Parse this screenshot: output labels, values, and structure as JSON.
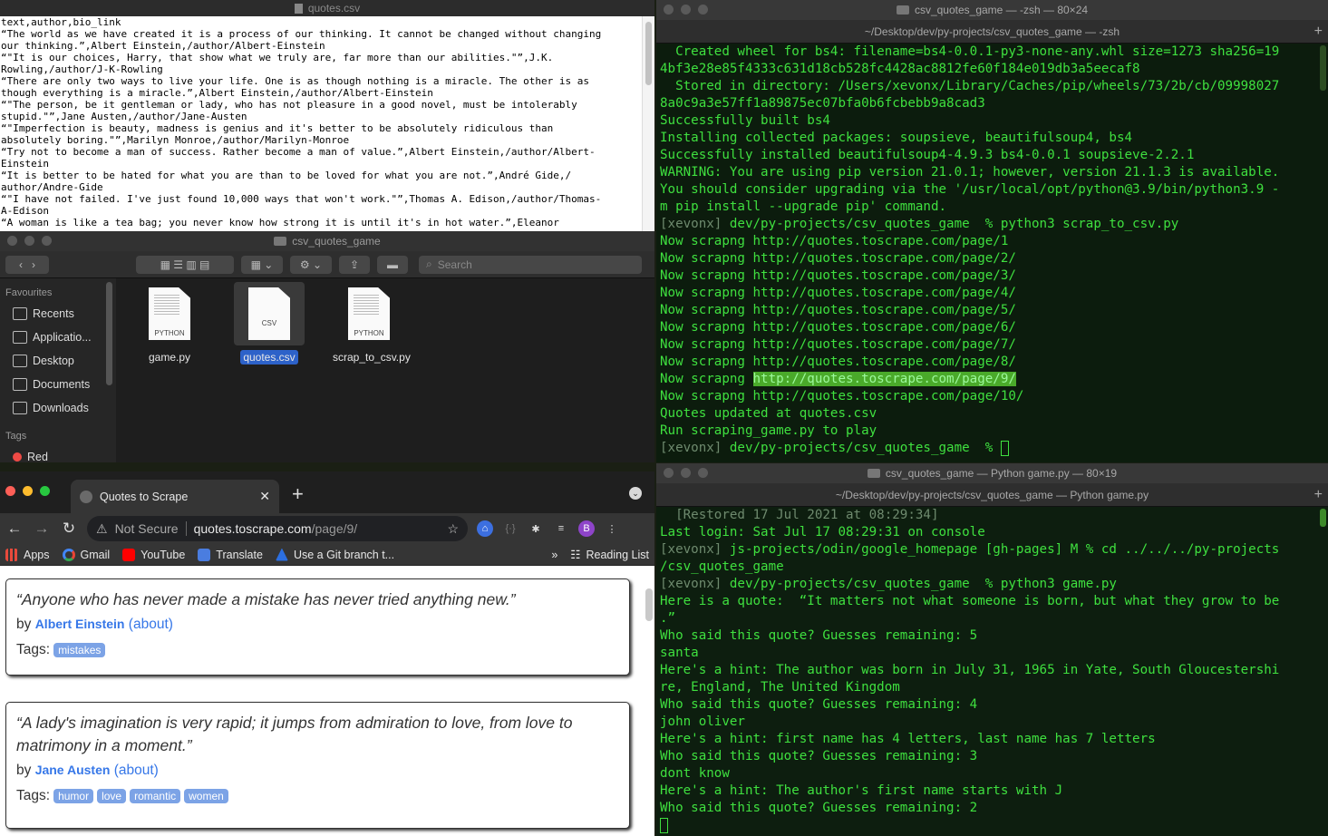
{
  "csv_window": {
    "title": "quotes.csv",
    "lines": [
      "text,author,bio_link",
      "“The world as we have created it is a process of our thinking. It cannot be changed without changing",
      "our thinking.”,Albert Einstein,/author/Albert-Einstein",
      "“\"It is our choices, Harry, that show what we truly are, far more than our abilities.\"”,J.K.",
      "Rowling,/author/J-K-Rowling",
      "“There are only two ways to live your life. One is as though nothing is a miracle. The other is as",
      "though everything is a miracle.”,Albert Einstein,/author/Albert-Einstein",
      "“\"The person, be it gentleman or lady, who has not pleasure in a good novel, must be intolerably",
      "stupid.\"”,Jane Austen,/author/Jane-Austen",
      "“\"Imperfection is beauty, madness is genius and it's better to be absolutely ridiculous than",
      "absolutely boring.\"”,Marilyn Monroe,/author/Marilyn-Monroe",
      "“Try not to become a man of success. Rather become a man of value.”,Albert Einstein,/author/Albert-",
      "Einstein",
      "“It is better to be hated for what you are than to be loved for what you are not.”,André Gide,/",
      "author/Andre-Gide",
      "“\"I have not failed. I've just found 10,000 ways that won't work.\"”,Thomas A. Edison,/author/Thomas-",
      "A-Edison",
      "“A woman is like a tea bag; you never know how strong it is until it's in hot water.”,Eleanor"
    ]
  },
  "finder": {
    "title": "csv_quotes_game",
    "search_placeholder": "Search",
    "favourites_label": "Favourites",
    "sidebar_items": [
      "Recents",
      "Applicatio...",
      "Desktop",
      "Documents",
      "Downloads"
    ],
    "tags_label": "Tags",
    "tag_red": "Red",
    "files": [
      {
        "name": "game.py",
        "type": "PYTHON"
      },
      {
        "name": "quotes.csv",
        "type": "CSV"
      },
      {
        "name": "scrap_to_csv.py",
        "type": "PYTHON"
      }
    ]
  },
  "terminal1": {
    "title": "csv_quotes_game — -zsh — 80×24",
    "subtitle": "~/Desktop/dev/py-projects/csv_quotes_game — -zsh",
    "lines": [
      "  Created wheel for bs4: filename=bs4-0.0.1-py3-none-any.whl size=1273 sha256=19",
      "4bf3e28e85f4333c631d18cb528fc4428ac8812fe60f184e019db3a5eecaf8",
      "  Stored in directory: /Users/xevonx/Library/Caches/pip/wheels/73/2b/cb/09998027",
      "8a0c9a3e57ff1a89875ec07bfa0b6fcbebb9a8cad3",
      "Successfully built bs4",
      "Installing collected packages: soupsieve, beautifulsoup4, bs4",
      "Successfully installed beautifulsoup4-4.9.3 bs4-0.0.1 soupsieve-2.2.1",
      "WARNING: You are using pip version 21.0.1; however, version 21.1.3 is available.",
      "You should consider upgrading via the '/usr/local/opt/python@3.9/bin/python3.9 -",
      "m pip install --upgrade pip' command."
    ],
    "prompt_user": "[xevonx]",
    "prompt_path": " dev/py-projects/csv_quotes_game  % ",
    "prompt_cmd": "python3 scrap_to_csv.py",
    "scrape_prefix": "Now scrapng ",
    "scrape_urls": [
      "http://quotes.toscrape.com/page/1",
      "http://quotes.toscrape.com/page/2/",
      "http://quotes.toscrape.com/page/3/",
      "http://quotes.toscrape.com/page/4/",
      "http://quotes.toscrape.com/page/5/",
      "http://quotes.toscrape.com/page/6/",
      "http://quotes.toscrape.com/page/7/",
      "http://quotes.toscrape.com/page/8/",
      "http://quotes.toscrape.com/page/9/",
      "http://quotes.toscrape.com/page/10/"
    ],
    "tail_lines": [
      "Quotes updated at quotes.csv",
      "Run scraping_game.py to play"
    ],
    "final_prompt_path": " dev/py-projects/csv_quotes_game  % "
  },
  "terminal2": {
    "title": "csv_quotes_game — Python game.py — 80×19",
    "subtitle": "~/Desktop/dev/py-projects/csv_quotes_game — Python game.py",
    "restored": "  [Restored 17 Jul 2021 at 08:29:34]",
    "login": "Last login: Sat Jul 17 08:29:31 on console",
    "prompt1_user": "[xevonx]",
    "prompt1_rest": " js-projects/odin/google_homepage [gh-pages] M % cd ../../../py-projects",
    "prompt1_cont": "/csv_quotes_game",
    "prompt2_user": "[xevonx]",
    "prompt2_rest": " dev/py-projects/csv_quotes_game  % python3 game.py",
    "lines": [
      "Here is a quote:  “It matters not what someone is born, but what they grow to be",
      ".”",
      "Who said this quote? Guesses remaining: 5",
      "santa",
      "Here's a hint: The author was born in July 31, 1965 in Yate, South Gloucestershi",
      "re, England, The United Kingdom",
      "Who said this quote? Guesses remaining: 4",
      "john oliver",
      "Here's a hint: first name has 4 letters, last name has 7 letters",
      "Who said this quote? Guesses remaining: 3",
      "dont know",
      "Here's a hint: The author's first name starts with J",
      "Who said this quote? Guesses remaining: 2"
    ]
  },
  "browser": {
    "tab_title": "Quotes to Scrape",
    "not_secure": "Not Secure",
    "url_host": "quotes.toscrape.com",
    "url_path": "/page/9/",
    "profile_initial": "B",
    "bookmarks": [
      "Apps",
      "Gmail",
      "YouTube",
      "Translate",
      "Use a Git branch t..."
    ],
    "reading_list": "Reading List",
    "overflow": "»",
    "quotes": [
      {
        "text": "“Anyone who has never made a mistake has never tried anything new.”",
        "by": "by ",
        "author": "Albert Einstein",
        "about": "(about)",
        "tags_label": "Tags:",
        "tags": [
          "mistakes"
        ]
      },
      {
        "text": "“A lady's imagination is very rapid; it jumps from admiration to love, from love to matrimony in a moment.”",
        "by": "by ",
        "author": "Jane Austen",
        "about": "(about)",
        "tags_label": "Tags:",
        "tags": [
          "humor",
          "love",
          "romantic",
          "women"
        ]
      }
    ]
  }
}
